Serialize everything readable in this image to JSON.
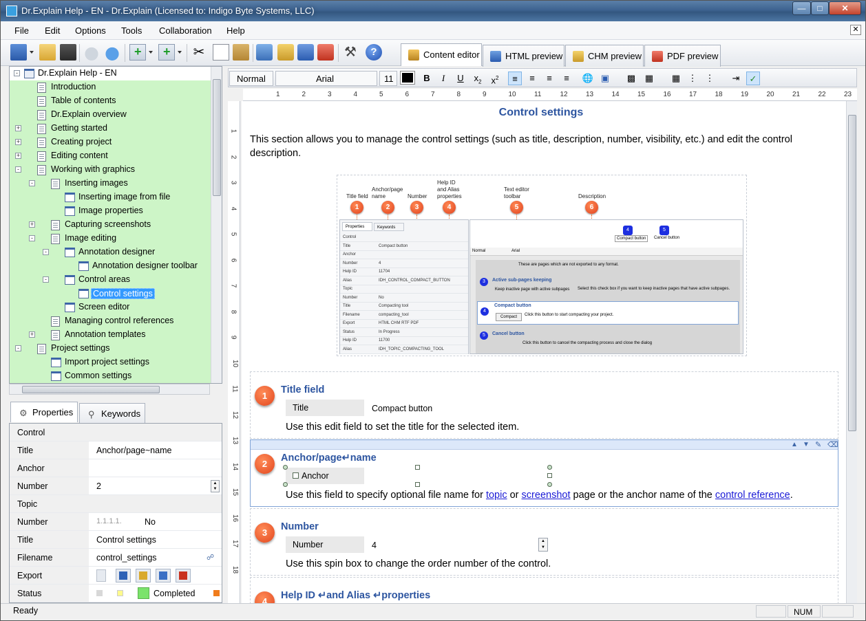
{
  "window": {
    "title": "Dr.Explain Help - EN - Dr.Explain (Licensed to: Indigo Byte Systems, LLC)"
  },
  "menu": [
    "File",
    "Edit",
    "Options",
    "Tools",
    "Collaboration",
    "Help"
  ],
  "editor_tabs": [
    "Content editor",
    "HTML preview",
    "CHM preview",
    "PDF preview"
  ],
  "format": {
    "style": "Normal",
    "font": "Arial",
    "size": "11"
  },
  "tree": {
    "root": "Dr.Explain Help - EN",
    "items": [
      {
        "label": "Introduction"
      },
      {
        "label": "Table of contents"
      },
      {
        "label": "Dr.Explain overview"
      },
      {
        "label": "Getting started"
      },
      {
        "label": "Creating project"
      },
      {
        "label": "Editing content"
      },
      {
        "label": "Working with graphics"
      },
      {
        "label": "Inserting images"
      },
      {
        "label": "Inserting image from file"
      },
      {
        "label": "Image properties"
      },
      {
        "label": "Capturing screenshots"
      },
      {
        "label": "Image editing"
      },
      {
        "label": "Annotation designer"
      },
      {
        "label": "Annotation designer toolbar"
      },
      {
        "label": "Control areas"
      },
      {
        "label": "Control settings"
      },
      {
        "label": "Screen editor"
      },
      {
        "label": "Managing control references"
      },
      {
        "label": "Annotation templates"
      },
      {
        "label": "Project settings"
      },
      {
        "label": "Import project settings"
      },
      {
        "label": "Common settings"
      }
    ]
  },
  "props_tabs": [
    "Properties",
    "Keywords"
  ],
  "properties": {
    "control_header": "Control",
    "title_key": "Title",
    "title_val": "Anchor/page~name",
    "anchor_key": "Anchor",
    "number_key": "Number",
    "number_val": "2",
    "topic_header": "Topic",
    "tnumber_key": "Number",
    "tnumber_num": "1.1.1.1.",
    "tnumber_val": "No",
    "ttitle_key": "Title",
    "ttitle_val": "Control settings",
    "filename_key": "Filename",
    "filename_val": "control_settings",
    "export_key": "Export",
    "status_key": "Status",
    "status_val": "Completed"
  },
  "doc": {
    "title": "Control settings",
    "intro": "This section allows you to manage the control settings (such as title, description, number, visibility, etc.) and edit the control description.",
    "image": {
      "callouts": [
        {
          "n": "1",
          "label": "Title field"
        },
        {
          "n": "2",
          "label": "Anchor/page name"
        },
        {
          "n": "3",
          "label": "Number"
        },
        {
          "n": "4",
          "label": "Help ID and Alias properties"
        },
        {
          "n": "5",
          "label": "Text editor toolbar"
        },
        {
          "n": "6",
          "label": "Description"
        }
      ],
      "mini_tabs": [
        "Properties",
        "Keywords"
      ],
      "mini_rows": [
        "Control",
        "Title",
        "Anchor",
        "Number",
        "Help ID",
        "Alias",
        "Topic",
        "Number",
        "Title",
        "Filename",
        "Export",
        "Status",
        "Help ID",
        "Alias"
      ],
      "mini_vals": [
        "",
        "Compact button",
        "",
        "4",
        "11704",
        "IDH_CONTROL_COMPACT_BUTTON",
        "",
        "No",
        "Compacting tool",
        "compacting_tool",
        "HTML  CHM  RTF  PDF",
        "In Progress",
        "11700",
        "IDH_TOPIC_COMPACTING_TOOL"
      ],
      "mini_text": {
        "compact": "Compact button",
        "cancel": "Cancel button",
        "sub_pages": "Active sub-pages keeping",
        "keep_chk": "Keep inactive page with active subpages",
        "keep_desc": "Select this check box if you want to keep inactive pages that have active subpages.",
        "compact_desc": "Click this button to start compacting your project.",
        "cancel_desc": "Click this button to cancel the compacting process and close the dialog",
        "pages_note": "These are pages which are not exported to any format.",
        "compact_btn": "Compact",
        "normal": "Normal",
        "arial": "Arial"
      }
    },
    "blocks": [
      {
        "n": "1",
        "title": "Title field",
        "label": "Title",
        "value": "Compact button",
        "desc": "Use this edit field to set the title for the selected item."
      },
      {
        "n": "2",
        "title": "Anchor/page↵name",
        "label": "Anchor",
        "value": "",
        "desc_pre": "Use this field to specify optional file name for ",
        "desc_l1": "topic",
        "desc_mid1": " or ",
        "desc_l2": "screenshot",
        "desc_mid2": " page or the anchor name of the ",
        "desc_l3": "control reference",
        "desc_end": "."
      },
      {
        "n": "3",
        "title": "Number",
        "label": "Number",
        "value": "4",
        "desc": "Use this spin box to change the order number of the control."
      },
      {
        "n": "4",
        "title": "Help ID ↵and Alias ↵properties"
      }
    ]
  },
  "status": {
    "ready": "Ready",
    "num": "NUM"
  },
  "colors": {
    "tree_bg": "#cdf5c7",
    "accent": "#2d55a0",
    "callout": "#e2461e"
  }
}
